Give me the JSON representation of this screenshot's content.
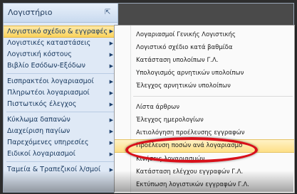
{
  "nav": {
    "header": "Λογιστήριο",
    "pin_icon": "pin-icon",
    "items": [
      {
        "label": "Λογιστικό σχέδιο & εγγραφές",
        "arrow": "▶"
      },
      {
        "label": "Λογιστικές καταστάσεις",
        "arrow": "▶"
      },
      {
        "label": "Λογιστική κόστους",
        "arrow": "▶"
      },
      {
        "label": "Βιβλίο Εσόδων-Εξόδων",
        "arrow": "▶"
      },
      {
        "label": "Εισπρακτέοι λογαριασμοί",
        "arrow": "▶"
      },
      {
        "label": "Πληρωτέοι λογαριασμοί",
        "arrow": "▶"
      },
      {
        "label": "Πιστωτικός έλεγχος",
        "arrow": "▶"
      },
      {
        "label": "Κύκλωμα δαπανών",
        "arrow": "▶"
      },
      {
        "label": "Διαχείριση παγίων",
        "arrow": "▶"
      },
      {
        "label": "Παρεχόμενες υπηρεσίες",
        "arrow": "▶"
      },
      {
        "label": "Ειδικοί λογαριασμοί",
        "arrow": "▶"
      },
      {
        "label": "Ταμεία & Τραπεζικοί λ/σμοί",
        "arrow": "▶"
      }
    ]
  },
  "submenu": {
    "items": [
      "Λογαριασμοί Γενικής Λογιστικής",
      "Λογιστικό σχέδιο κατά βαθμίδα",
      "Κατάσταση υπολοίπων Γ.Λ.",
      "Υπολογισμός αρνητικών υπολοίπων",
      "Έλεγχος αρνητικών υπολοίπων",
      "Λίστα άρθρων",
      "Έλεγχος ημερολογίων",
      "Αιτιολόγηση προέλευσης εγγραφών",
      "Προέλευση ποσών ανά λογαριασμό",
      "Κινήσεις λογαριασμών",
      "Κατάσταση ελέγχου εγγραφών Γ.Λ.",
      "Εκτύπωση λογιστικών εγγραφών Γ.Λ."
    ]
  },
  "colors": {
    "highlight_ring": "#d8101a",
    "nav_bg": "#dfe9f6",
    "active_item": "#fbd35d"
  }
}
